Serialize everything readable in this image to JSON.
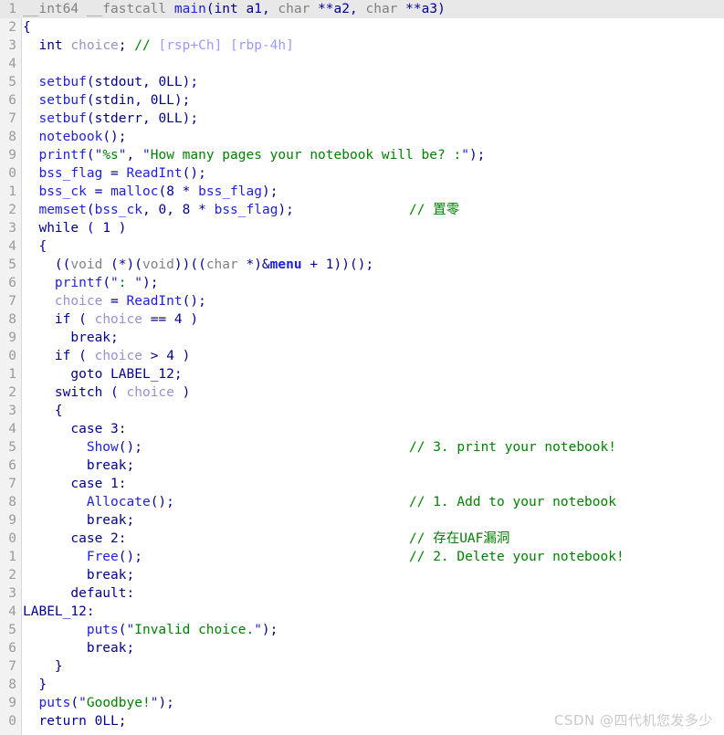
{
  "view": {
    "title": "IDA Pseudocode - main",
    "watermark": "CSDN @四代机您发多少",
    "colors": {
      "background": "#ffffff",
      "gutter": "#f2f2f2",
      "current_line_highlight": "#e8e8e8",
      "keyword": "#00008b",
      "function": "#2020e0",
      "type": "#808080",
      "local_variable": "#9a8fd0",
      "string": "#008000",
      "comment": "#008000",
      "comment_ref": "#9a9aff",
      "line_number": "#9a9a9a",
      "watermark": "#c9c9c9"
    }
  },
  "code": {
    "current_line": 1,
    "lines": [
      {
        "n": "1",
        "num_display": "1",
        "text": "__int64 __fastcall main(int a1, char **a2, char **a3)",
        "comment": ""
      },
      {
        "n": "2",
        "num_display": "2",
        "text": "{",
        "comment": ""
      },
      {
        "n": "3",
        "num_display": "3",
        "text": "  int choice; // [rsp+Ch] [rbp-4h]",
        "comment": ""
      },
      {
        "n": "4",
        "num_display": "4",
        "text": "",
        "comment": ""
      },
      {
        "n": "5",
        "num_display": "5",
        "text": "  setbuf(stdout, 0LL);",
        "comment": ""
      },
      {
        "n": "6",
        "num_display": "6",
        "text": "  setbuf(stdin, 0LL);",
        "comment": ""
      },
      {
        "n": "7",
        "num_display": "7",
        "text": "  setbuf(stderr, 0LL);",
        "comment": ""
      },
      {
        "n": "8",
        "num_display": "8",
        "text": "  notebook();",
        "comment": ""
      },
      {
        "n": "9",
        "num_display": "9",
        "text": "  printf(\"%s\", \"How many pages your notebook will be? :\");",
        "comment": ""
      },
      {
        "n": "10",
        "num_display": "0",
        "text": "  bss_flag = ReadInt();",
        "comment": ""
      },
      {
        "n": "11",
        "num_display": "1",
        "text": "  bss_ck = malloc(8 * bss_flag);",
        "comment": ""
      },
      {
        "n": "12",
        "num_display": "2",
        "text": "  memset(bss_ck, 0, 8 * bss_flag);",
        "comment": "// 置零"
      },
      {
        "n": "13",
        "num_display": "3",
        "text": "  while ( 1 )",
        "comment": ""
      },
      {
        "n": "14",
        "num_display": "4",
        "text": "  {",
        "comment": ""
      },
      {
        "n": "15",
        "num_display": "5",
        "text": "    ((void (*)(void))((char *)&menu + 1))();",
        "comment": ""
      },
      {
        "n": "16",
        "num_display": "6",
        "text": "    printf(\": \");",
        "comment": ""
      },
      {
        "n": "17",
        "num_display": "7",
        "text": "    choice = ReadInt();",
        "comment": ""
      },
      {
        "n": "18",
        "num_display": "8",
        "text": "    if ( choice == 4 )",
        "comment": ""
      },
      {
        "n": "19",
        "num_display": "9",
        "text": "      break;",
        "comment": ""
      },
      {
        "n": "20",
        "num_display": "0",
        "text": "    if ( choice > 4 )",
        "comment": ""
      },
      {
        "n": "21",
        "num_display": "1",
        "text": "      goto LABEL_12;",
        "comment": ""
      },
      {
        "n": "22",
        "num_display": "2",
        "text": "    switch ( choice )",
        "comment": ""
      },
      {
        "n": "23",
        "num_display": "3",
        "text": "    {",
        "comment": ""
      },
      {
        "n": "24",
        "num_display": "4",
        "text": "      case 3:",
        "comment": ""
      },
      {
        "n": "25",
        "num_display": "5",
        "text": "        Show();",
        "comment": "// 3. print your notebook!"
      },
      {
        "n": "26",
        "num_display": "6",
        "text": "        break;",
        "comment": ""
      },
      {
        "n": "27",
        "num_display": "7",
        "text": "      case 1:",
        "comment": ""
      },
      {
        "n": "28",
        "num_display": "8",
        "text": "        Allocate();",
        "comment": "// 1. Add to your notebook"
      },
      {
        "n": "29",
        "num_display": "9",
        "text": "        break;",
        "comment": ""
      },
      {
        "n": "30",
        "num_display": "0",
        "text": "      case 2:",
        "comment": "// 存在UAF漏洞"
      },
      {
        "n": "31",
        "num_display": "1",
        "text": "        Free();",
        "comment": "// 2. Delete your notebook!"
      },
      {
        "n": "32",
        "num_display": "2",
        "text": "        break;",
        "comment": ""
      },
      {
        "n": "33",
        "num_display": "3",
        "text": "      default:",
        "comment": ""
      },
      {
        "n": "34",
        "num_display": "4",
        "text": "LABEL_12:",
        "comment": ""
      },
      {
        "n": "35",
        "num_display": "5",
        "text": "        puts(\"Invalid choice.\");",
        "comment": ""
      },
      {
        "n": "36",
        "num_display": "6",
        "text": "        break;",
        "comment": ""
      },
      {
        "n": "37",
        "num_display": "7",
        "text": "    }",
        "comment": ""
      },
      {
        "n": "38",
        "num_display": "8",
        "text": "  }",
        "comment": ""
      },
      {
        "n": "39",
        "num_display": "9",
        "text": "  puts(\"Goodbye!\");",
        "comment": ""
      },
      {
        "n": "40",
        "num_display": "0",
        "text": "  return 0LL;",
        "comment": ""
      }
    ]
  }
}
